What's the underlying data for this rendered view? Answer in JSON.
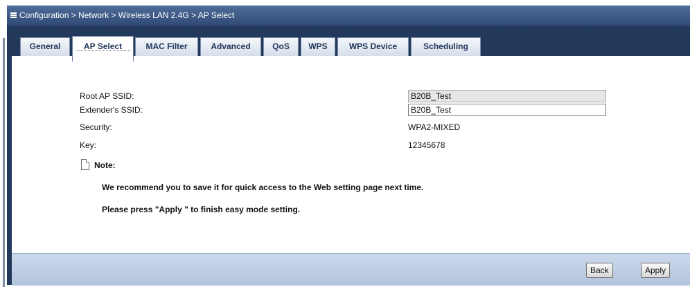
{
  "breadcrumb": "Configuration > Network > Wireless LAN 2.4G > AP Select",
  "tabs": [
    {
      "label": "General",
      "active": false
    },
    {
      "label": "AP Select",
      "active": true
    },
    {
      "label": "MAC Filter",
      "active": false
    },
    {
      "label": "Advanced",
      "active": false
    },
    {
      "label": "QoS",
      "active": false
    },
    {
      "label": "WPS",
      "active": false
    },
    {
      "label": "WPS Device",
      "active": false
    },
    {
      "label": "Scheduling",
      "active": false
    }
  ],
  "form": {
    "root_ssid": {
      "label": "Root AP SSID:",
      "value": "B20B_Test"
    },
    "extender_ssid": {
      "label": "Extender's SSID:",
      "value": "B20B_Test"
    },
    "security": {
      "label": "Security:",
      "value": "WPA2-MIXED"
    },
    "key": {
      "label": "Key:",
      "value": "12345678"
    }
  },
  "note": {
    "title": "Note:",
    "line1": "We recommend you to save it for quick access to the Web setting page next time.",
    "line2": "Please press \"Apply \" to finish easy mode setting."
  },
  "buttons": {
    "back": "Back",
    "apply": "Apply"
  },
  "colors": {
    "header_bg": "#23395c",
    "breadcrumb_bg": "#3d5a86",
    "footer_bg": "#c3d1e6",
    "tab_text": "#1f3558"
  }
}
